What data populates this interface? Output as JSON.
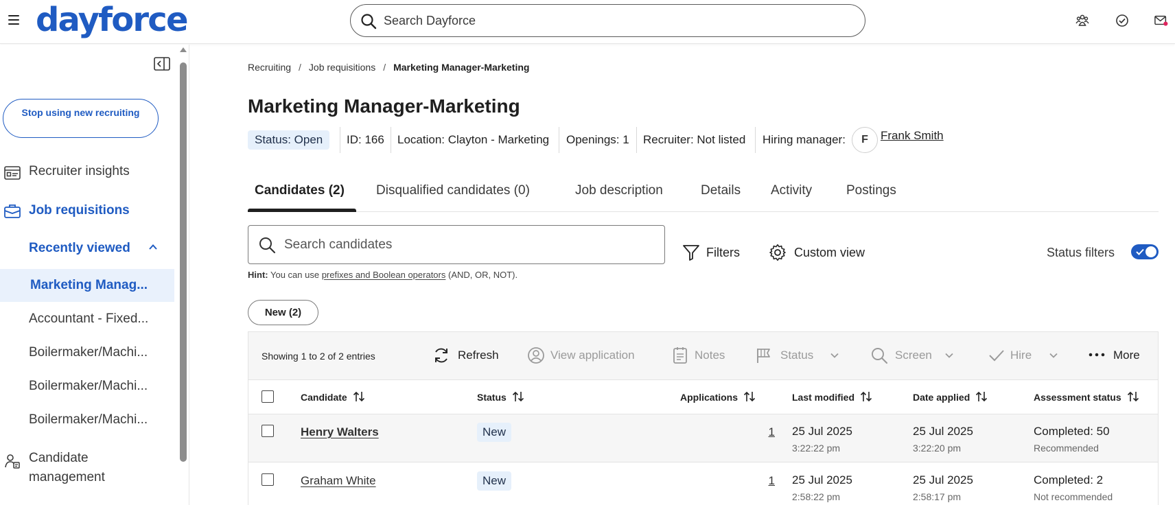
{
  "header": {
    "logo": "dayforce",
    "search_placeholder": "Search Dayforce"
  },
  "sidebar": {
    "stop_button": "Stop using new recruiting",
    "nav": {
      "recruiter_insights": "Recruiter insights",
      "job_requisitions": "Job requisitions",
      "recently_viewed": "Recently viewed",
      "candidate_management_1": "Candidate",
      "candidate_management_2": "management"
    },
    "recent_items": [
      "Marketing Manag...",
      "Accountant - Fixed...",
      "Boilermaker/Machi...",
      "Boilermaker/Machi...",
      "Boilermaker/Machi..."
    ]
  },
  "breadcrumb": {
    "items": [
      "Recruiting",
      "Job requisitions"
    ],
    "current": "Marketing Manager-Marketing",
    "separator": "/"
  },
  "page": {
    "title": "Marketing Manager-Marketing"
  },
  "meta": {
    "status": "Status: Open",
    "id": "ID: 166",
    "location": "Location: Clayton - Marketing",
    "openings": "Openings: 1",
    "recruiter": "Recruiter: Not listed",
    "hiring_manager_label": "Hiring manager:",
    "hiring_manager_initial": "F",
    "hiring_manager_name": "Frank Smith"
  },
  "tabs": [
    "Candidates (2)",
    "Disqualified candidates (0)",
    "Job description",
    "Details",
    "Activity",
    "Postings"
  ],
  "search": {
    "placeholder": "Search candidates",
    "hint_label": "Hint:",
    "hint_pre": " You can use ",
    "hint_link": "prefixes and Boolean operators",
    "hint_post": " (AND, OR, NOT)."
  },
  "tools": {
    "filters": "Filters",
    "custom_view": "Custom view",
    "status_filters": "Status filters",
    "status_filters_on": true
  },
  "chip": "New (2)",
  "grid": {
    "count_text": "Showing 1 to 2 of 2 entries",
    "toolbar": {
      "refresh": "Refresh",
      "view_application": "View application",
      "notes": "Notes",
      "status": "Status",
      "screen": "Screen",
      "hire": "Hire",
      "more": "More"
    },
    "columns": {
      "candidate": "Candidate",
      "status": "Status",
      "applications": "Applications",
      "last_modified": "Last modified",
      "date_applied": "Date applied",
      "assessment_status": "Assessment status"
    },
    "rows": [
      {
        "candidate": "Henry Walters",
        "status": "New",
        "applications": "1",
        "last_modified_date": "25 Jul 2025",
        "last_modified_time": "3:22:22 pm",
        "date_applied_date": "25 Jul 2025",
        "date_applied_time": "3:22:20 pm",
        "assessment": "Completed: 50",
        "assessment_note": "Recommended"
      },
      {
        "candidate": "Graham White",
        "status": "New",
        "applications": "1",
        "last_modified_date": "25 Jul 2025",
        "last_modified_time": "2:58:22 pm",
        "date_applied_date": "25 Jul 2025",
        "date_applied_time": "2:58:17 pm",
        "assessment": "Completed: 2",
        "assessment_note": "Not recommended"
      }
    ]
  },
  "colors": {
    "brand": "#1f5bc2",
    "badge_bg": "#e6f0fb",
    "selected_bg": "#e9f1fc"
  },
  "icons": {
    "menu": "hamburger-icon",
    "search": "search-icon",
    "people": "people-icon",
    "tasks": "check-circle-icon",
    "mail": "mail-icon",
    "collapse": "collapse-sidebar-icon",
    "insights": "dashboard-icon",
    "jobs": "briefcase-icon",
    "candidates": "candidate-management-icon"
  }
}
